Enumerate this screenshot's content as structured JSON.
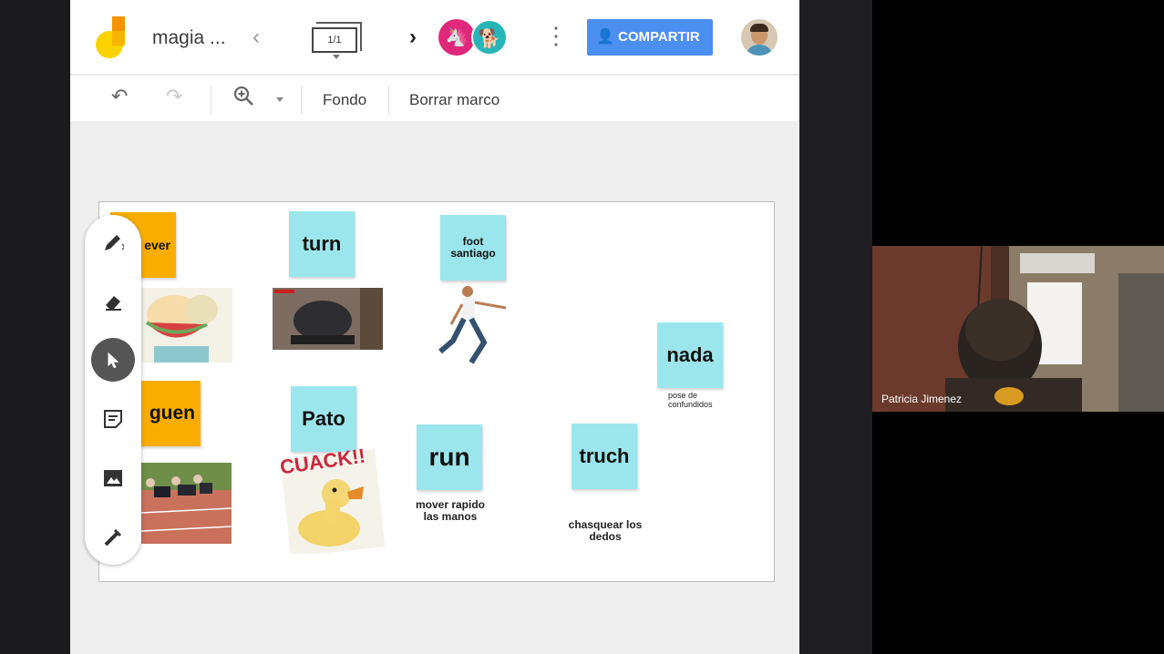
{
  "header": {
    "title": "magia ...",
    "frame_counter": "1/1",
    "share_label": "COMPARTIR"
  },
  "toolbar": {
    "background_label": "Fondo",
    "clear_frame_label": "Borrar marco"
  },
  "canvas": {
    "notes": {
      "ever": "ever",
      "turn": "turn",
      "foot": "foot santiago",
      "nada": "nada",
      "guen": "guen",
      "pato": "Pato",
      "run": "run",
      "truch": "truch"
    },
    "captions": {
      "nada": "pose de confundidos",
      "run": "mover rapido las manos",
      "truch": "chasquear los dedos",
      "cuack": "CUACK!!"
    }
  },
  "participant": {
    "name": "Patricia Jimenez"
  },
  "icons": [
    "undo-icon",
    "redo-icon",
    "zoom-icon",
    "pen-icon",
    "eraser-icon",
    "select-icon",
    "sticky-note-icon",
    "image-icon",
    "laser-icon",
    "more-icon",
    "share-icon"
  ],
  "colors": {
    "share_button": "#4b8ff0",
    "note_cyan": "#9be6ec",
    "note_orange": "#f9ad00"
  }
}
